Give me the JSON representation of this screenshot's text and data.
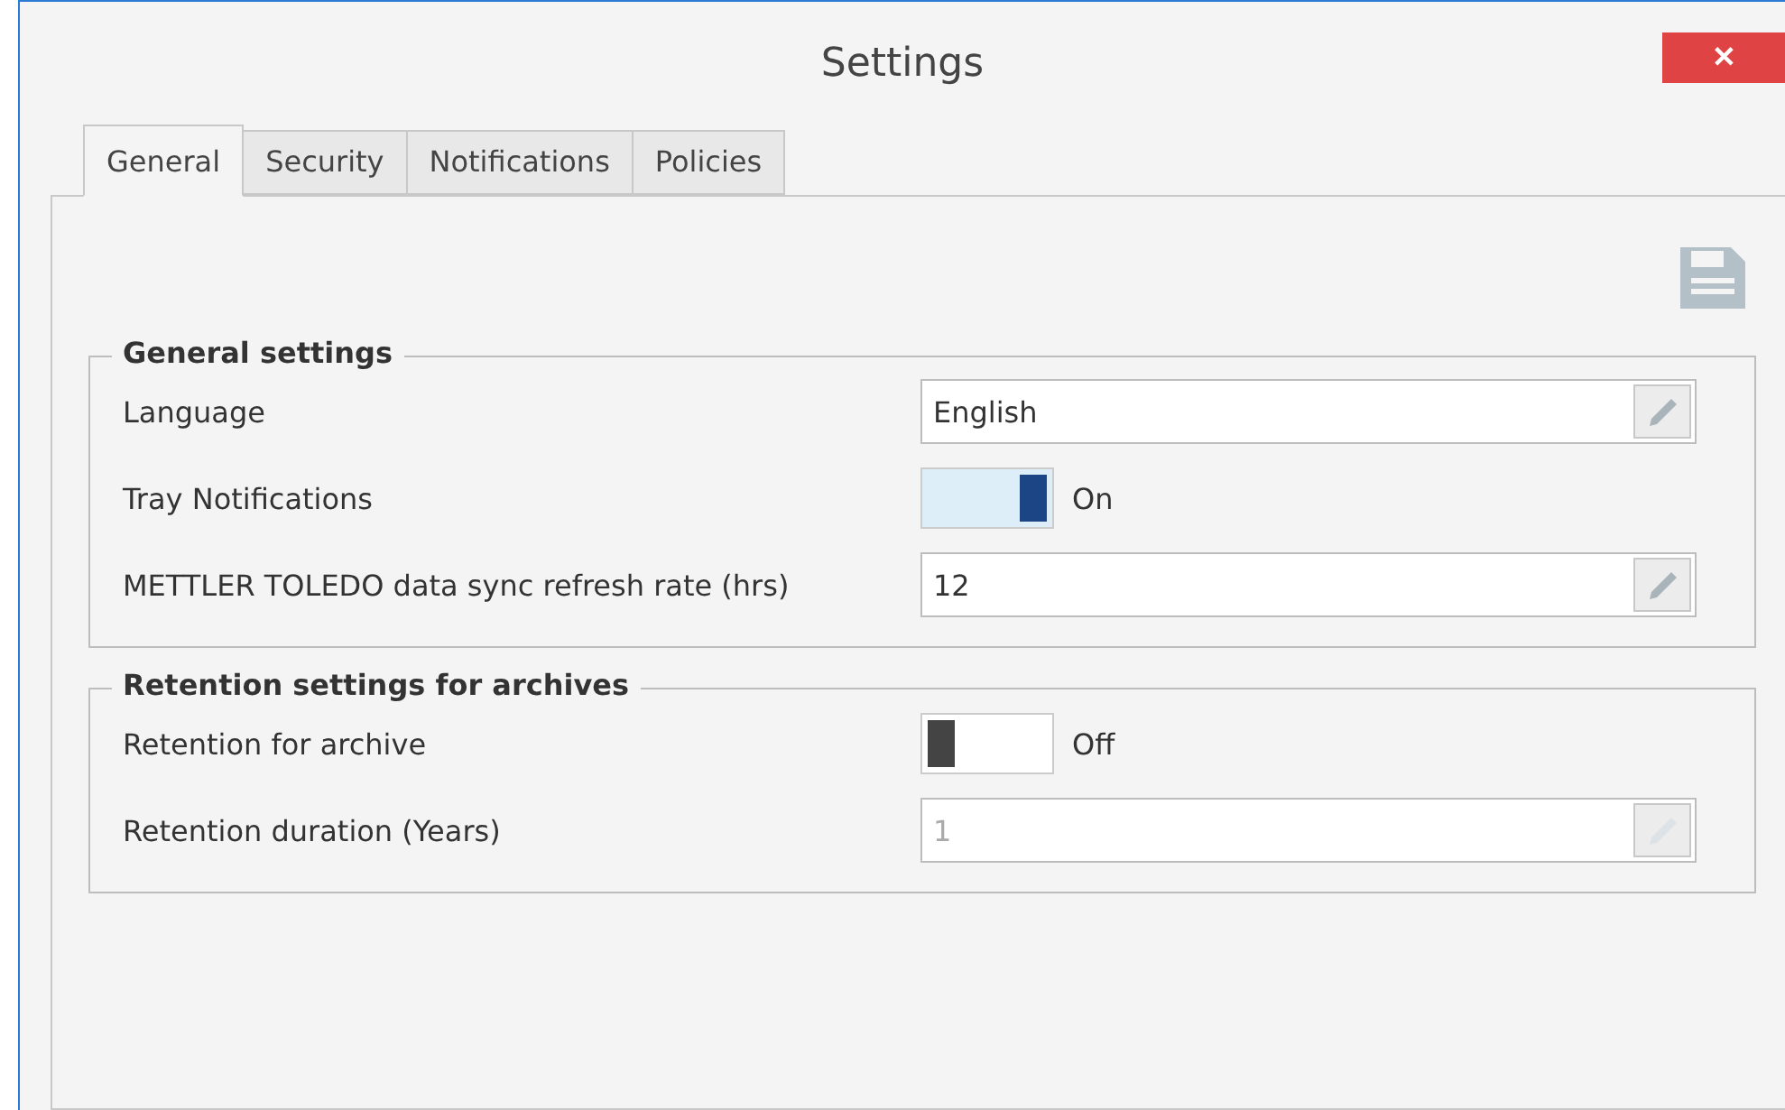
{
  "window": {
    "title": "Settings",
    "close": "✕"
  },
  "tabs": [
    {
      "label": "General",
      "selected": true
    },
    {
      "label": "Security",
      "selected": false
    },
    {
      "label": "Notifications",
      "selected": false
    },
    {
      "label": "Policies",
      "selected": false
    }
  ],
  "sections": [
    {
      "title": "General settings",
      "rows": [
        {
          "kind": "field",
          "label": "Language",
          "value": "English",
          "disabled": false
        },
        {
          "kind": "toggle",
          "label": "Tray Notifications",
          "on": true,
          "state": "On"
        },
        {
          "kind": "field",
          "label": "METTLER TOLEDO data sync refresh rate (hrs)",
          "value": "12",
          "disabled": false
        }
      ]
    },
    {
      "title": "Retention settings for archives",
      "rows": [
        {
          "kind": "toggle",
          "label": "Retention for archive",
          "on": false,
          "state": "Off"
        },
        {
          "kind": "field",
          "label": "Retention duration (Years)",
          "value": "1",
          "disabled": true
        }
      ]
    }
  ]
}
